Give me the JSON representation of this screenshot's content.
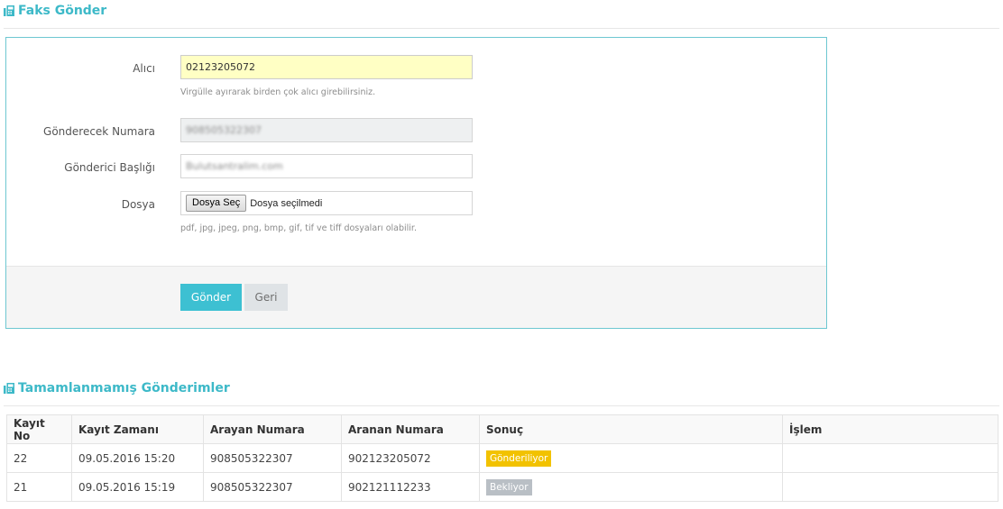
{
  "fax_section": {
    "title": "Faks Gönder",
    "icon": "fax-icon",
    "fields": {
      "recipient": {
        "label": "Alıcı",
        "value": "02123205072",
        "help": "Virgülle ayırarak birden çok alıcı girebilirsiniz."
      },
      "sender_number": {
        "label": "Gönderecek Numara",
        "value": "908505322307"
      },
      "sender_header": {
        "label": "Gönderici Başlığı",
        "value": "Bulutsantralim.com"
      },
      "file": {
        "label": "Dosya",
        "button_label": "Dosya Seç",
        "status": "Dosya seçilmedi",
        "help": "pdf, jpg, jpeg, png, bmp, gif, tif ve tiff dosyaları olabilir."
      }
    },
    "actions": {
      "submit_label": "Gönder",
      "back_label": "Geri"
    }
  },
  "pending_section": {
    "title": "Tamamlanmamış Gönderimler",
    "icon": "fax-icon",
    "columns": [
      "Kayıt No",
      "Kayıt Zamanı",
      "Arayan Numara",
      "Aranan Numara",
      "Sonuç",
      "İşlem"
    ],
    "rows": [
      {
        "record_no": "22",
        "time": "09.05.2016 15:20",
        "caller": "908505322307",
        "callee": "902123205072",
        "result": "Gönderiliyor",
        "result_color": "#f2c200",
        "action": ""
      },
      {
        "record_no": "21",
        "time": "09.05.2016 15:19",
        "caller": "908505322307",
        "callee": "902121112233",
        "result": "Bekliyor",
        "result_color": "#b9bfc5",
        "action": ""
      }
    ]
  },
  "colors": {
    "accent": "#3db9c8",
    "primary_button": "#3dc0d2"
  }
}
